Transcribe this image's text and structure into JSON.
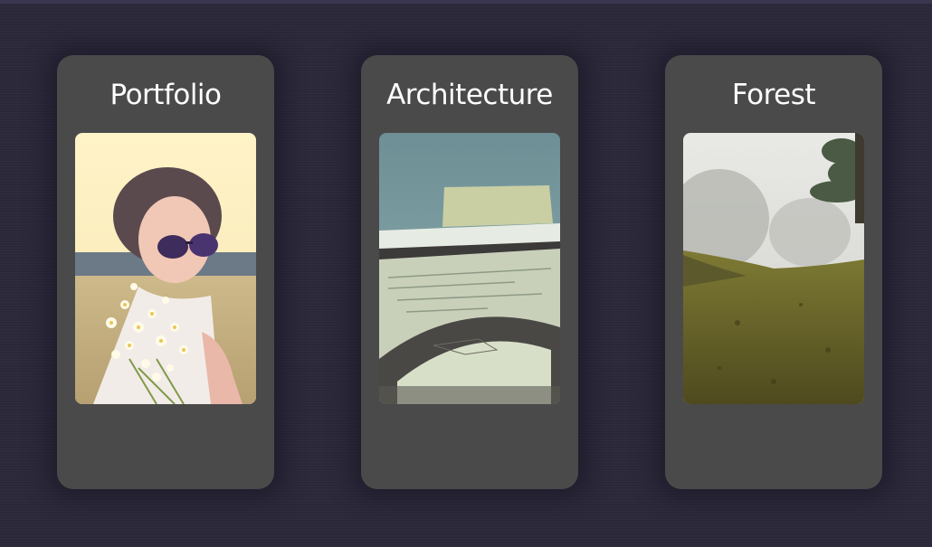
{
  "gallery": {
    "cards": [
      {
        "title": "Portfolio",
        "photo": "portrait-of-woman-in-sunglasses-with-daisies"
      },
      {
        "title": "Architecture",
        "photo": "blueprint-drawing-table"
      },
      {
        "title": "Forest",
        "photo": "foggy-meadow-with-tree"
      }
    ]
  },
  "colors": {
    "background": "#2b2839",
    "card": "#4a4a4a",
    "title_text": "#ffffff"
  }
}
